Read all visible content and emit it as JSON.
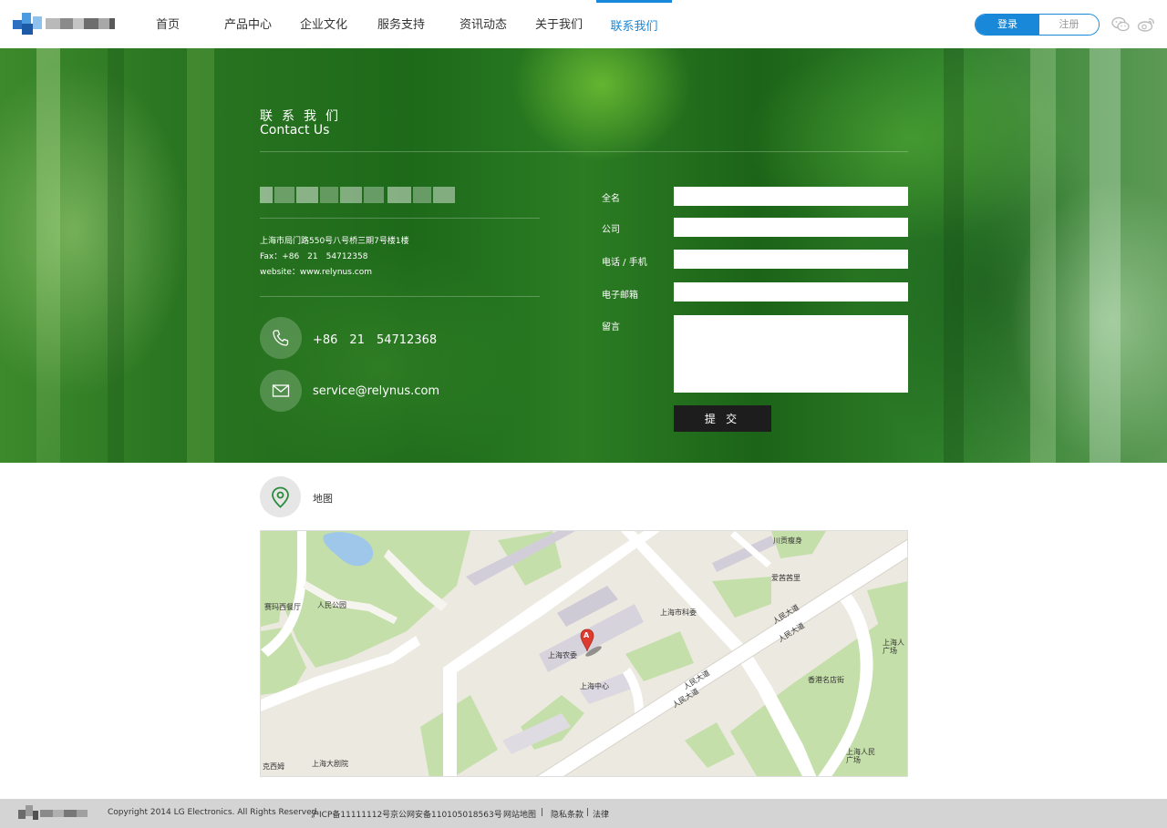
{
  "nav": {
    "items": [
      {
        "label": "首页"
      },
      {
        "label": "产品中心"
      },
      {
        "label": "企业文化"
      },
      {
        "label": "服务支持"
      },
      {
        "label": "资讯动态"
      },
      {
        "label": "关于我们"
      },
      {
        "label": "联系我们"
      }
    ],
    "active": "联系我们",
    "login_label": "登录",
    "register_label": "注册",
    "social_icons": [
      "wechat-icon",
      "weibo-icon"
    ]
  },
  "hero": {
    "title_cn": "联系我们",
    "title_en": "Contact Us",
    "address": "上海市局门路550号八号桥三期7号楼1楼",
    "fax": "Fax：+86　21　54712358",
    "website": "website：www.relynus.com",
    "phone": "+86　21　54712368",
    "email": "service@relynus.com"
  },
  "form": {
    "fields": [
      {
        "label": "全名",
        "value": ""
      },
      {
        "label": "公司",
        "value": ""
      },
      {
        "label": "电话 / 手机",
        "value": ""
      },
      {
        "label": "电子邮箱",
        "value": ""
      }
    ],
    "message_label": "留言",
    "message_value": "",
    "submit_label": "提 交"
  },
  "map": {
    "title": "地图",
    "marker_letter": "A",
    "labels": [
      "川贡瘦身",
      "爱茜茜里",
      "赛玛西餐厅",
      "人民公园",
      "上海市科委",
      "人民大道",
      "人民大道",
      "上海农委",
      "上海人\n广场",
      "上海中心",
      "香港名店街",
      "人民大道",
      "人民大道",
      "克西姆",
      "上海大剧院",
      "上海人民\n广场"
    ]
  },
  "footer": {
    "copyright": "Copyright 2014 LG Electronics. All Rights Reserved.",
    "icp": "沪ICP备11111112号",
    "police": "京公网安备110105018563号",
    "sitemap": "网站地图",
    "privacy": "隐私条款",
    "legal": "法律",
    "separator": "|"
  },
  "colors": {
    "accent": "#1a88d8",
    "submit_bg": "#1d1d1d",
    "footer_bg": "#d4d4d4",
    "map_green": "#c5dfaa",
    "map_marker": "#dd3b2f"
  }
}
